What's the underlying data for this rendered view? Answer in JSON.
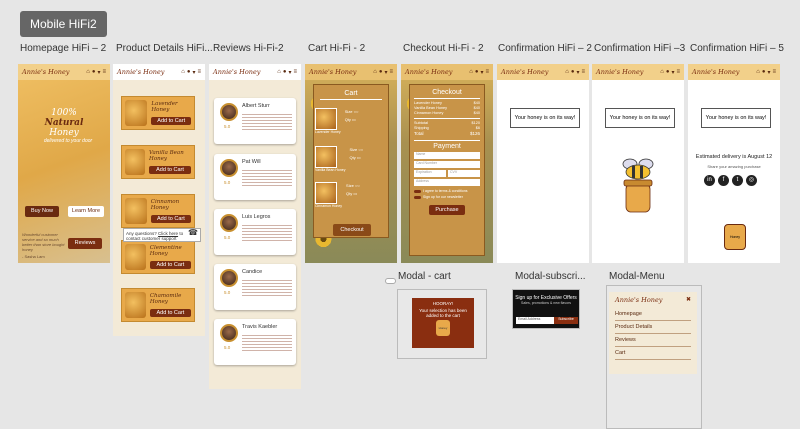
{
  "section": {
    "title": "Mobile HiFi2"
  },
  "frames": [
    {
      "label": "Homepage HiFi – 2"
    },
    {
      "label": "Product Details  HiFi..."
    },
    {
      "label": "Reviews Hi-Fi-2"
    },
    {
      "label": "Cart  Hi-Fi - 2"
    },
    {
      "label": "Checkout Hi-Fi - 2"
    },
    {
      "label": "Confirmation   HiFi – 2"
    },
    {
      "label": "Confirmation    HiFi –3"
    },
    {
      "label": "Confirmation    HiFi – 5"
    }
  ],
  "brand": {
    "logo": "Annie's Honey"
  },
  "homepage": {
    "headline_pre": "100%",
    "headline_mid": "Natural",
    "headline_post": "Honey",
    "tagline": "delivered to your door",
    "buy_now": "Buy Now",
    "learn_more": "Learn More",
    "testimonial": "Wonderful customer service and so much better than store bought honey",
    "testimonial_author": "- Sasha Lam",
    "reviews_button": "Reviews"
  },
  "products": [
    {
      "name": "Lavender Honey",
      "button": "Add to Cart"
    },
    {
      "name": "Vanilla Bean Honey",
      "button": "Add to Cart"
    },
    {
      "name": "Cinnamon Honey",
      "button": "Add to Cart"
    },
    {
      "name": "Clementine Honey",
      "button": "Add to Cart"
    },
    {
      "name": "Chamomile Honey",
      "button": "Add to Cart"
    }
  ],
  "support_popup": {
    "text_pre": "Any questions?",
    "link": "Click here",
    "text_post": "to contact customer support"
  },
  "reviews": [
    {
      "name": "Albert Sturr",
      "rating": "5.0"
    },
    {
      "name": "Pat Will",
      "rating": "5.0"
    },
    {
      "name": "Luis Legros",
      "rating": "5.0"
    },
    {
      "name": "Candice",
      "rating": "5.0"
    },
    {
      "name": "Travis Kaebler",
      "rating": "5.0"
    }
  ],
  "cart": {
    "title": "Cart",
    "items": [
      {
        "name": "Lavender Honey",
        "size": "Size",
        "qty": "Qty"
      },
      {
        "name": "Vanilla Bean Honey",
        "size": "Size",
        "qty": "Qty"
      },
      {
        "name": "Cinnamon Honey",
        "size": "Size",
        "qty": "Qty"
      }
    ],
    "size_options": [
      "1 lb",
      "2 lb",
      "4 lb"
    ],
    "checkout_button": "Checkout"
  },
  "checkout": {
    "title": "Checkout",
    "lines": [
      {
        "label": "Lavender Honey",
        "amount": "$40"
      },
      {
        "label": "Vanilla Bean Honey",
        "amount": "$40"
      },
      {
        "label": "Cinnamon Honey",
        "amount": "$40"
      }
    ],
    "subtotal_label": "Subtotal",
    "subtotal": "$120",
    "shipping_label": "Shipping",
    "shipping": "$6",
    "total_label": "Total",
    "total": "$126",
    "payment_title": "Payment",
    "fields": [
      "Name",
      "Card Number",
      "Expiration",
      "CVV",
      "Address"
    ],
    "agree_text": "I agree to terms & conditions",
    "signup_text": "Sign up for our newsletter",
    "purchase_button": "Purchase"
  },
  "confirmation": {
    "message": "Your honey is on its way!",
    "estimated": "Estimated delivery is August 12",
    "share": "Share your amazing purchase",
    "jar_label": "Honey"
  },
  "modals": [
    {
      "label": "Modal - cart"
    },
    {
      "label": "Modal-subscri..."
    },
    {
      "label": "Modal-Menu"
    }
  ],
  "modal_cart": {
    "title": "HOORAY!",
    "text": "Your selection has been added to the cart",
    "jar_label": "Honey"
  },
  "modal_sub": {
    "title": "Sign up for Exclusive Offers",
    "subtitle": "Sales, promotions & new flavors",
    "placeholder": "Email Address",
    "button": "Subscribe"
  },
  "modal_menu": {
    "logo": "Annie's Honey",
    "items": [
      "Homepage",
      "Product Details",
      "Reviews",
      "Cart"
    ]
  },
  "colors": {
    "brand": "#7a2d10",
    "honey": "#e8a94a",
    "cream": "#f3ead7"
  }
}
